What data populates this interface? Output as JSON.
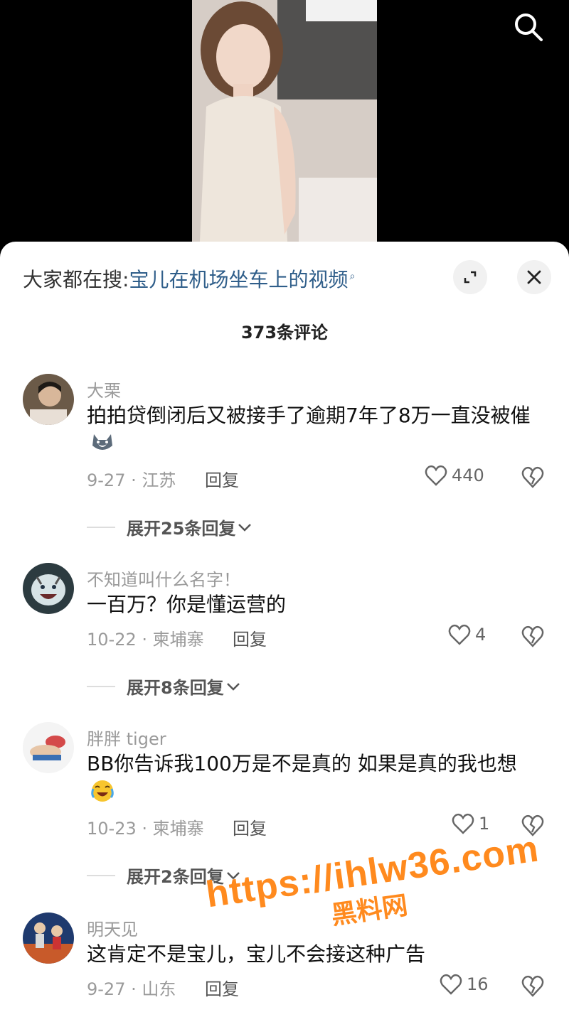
{
  "header": {
    "search_prefix": "大家都在搜:",
    "search_query": "宝儿在机场坐车上的视频",
    "comment_count": "373条评论"
  },
  "comments": [
    {
      "username": "大栗",
      "text": "拍拍贷倒闭后又被接手了逾期7年了8万一直没被催",
      "date_location": "9-27 · 江苏",
      "reply_label": "回复",
      "likes": "440",
      "expand_label": "展开25条回复"
    },
    {
      "username": "不知道叫什么名字！",
      "text": "一百万？你是懂运营的",
      "date_location": "10-22 · 柬埔寨",
      "reply_label": "回复",
      "likes": "4",
      "expand_label": "展开8条回复"
    },
    {
      "username": "胖胖 tiger",
      "text": "BB你告诉我100万是不是真的 如果是真的我也想",
      "date_location": "10-23 · 柬埔寨",
      "reply_label": "回复",
      "likes": "1",
      "expand_label": "展开2条回复"
    },
    {
      "username": "明天见",
      "text": "这肯定不是宝儿，宝儿不会接这种广告",
      "date_location": "9-27 · 山东",
      "reply_label": "回复",
      "likes": "16"
    }
  ],
  "watermark": {
    "url": "https://ihlw36.com",
    "name": "黑料网"
  },
  "colors": {
    "link": "#2f5e8a",
    "watermark": "#ff8a1e"
  }
}
